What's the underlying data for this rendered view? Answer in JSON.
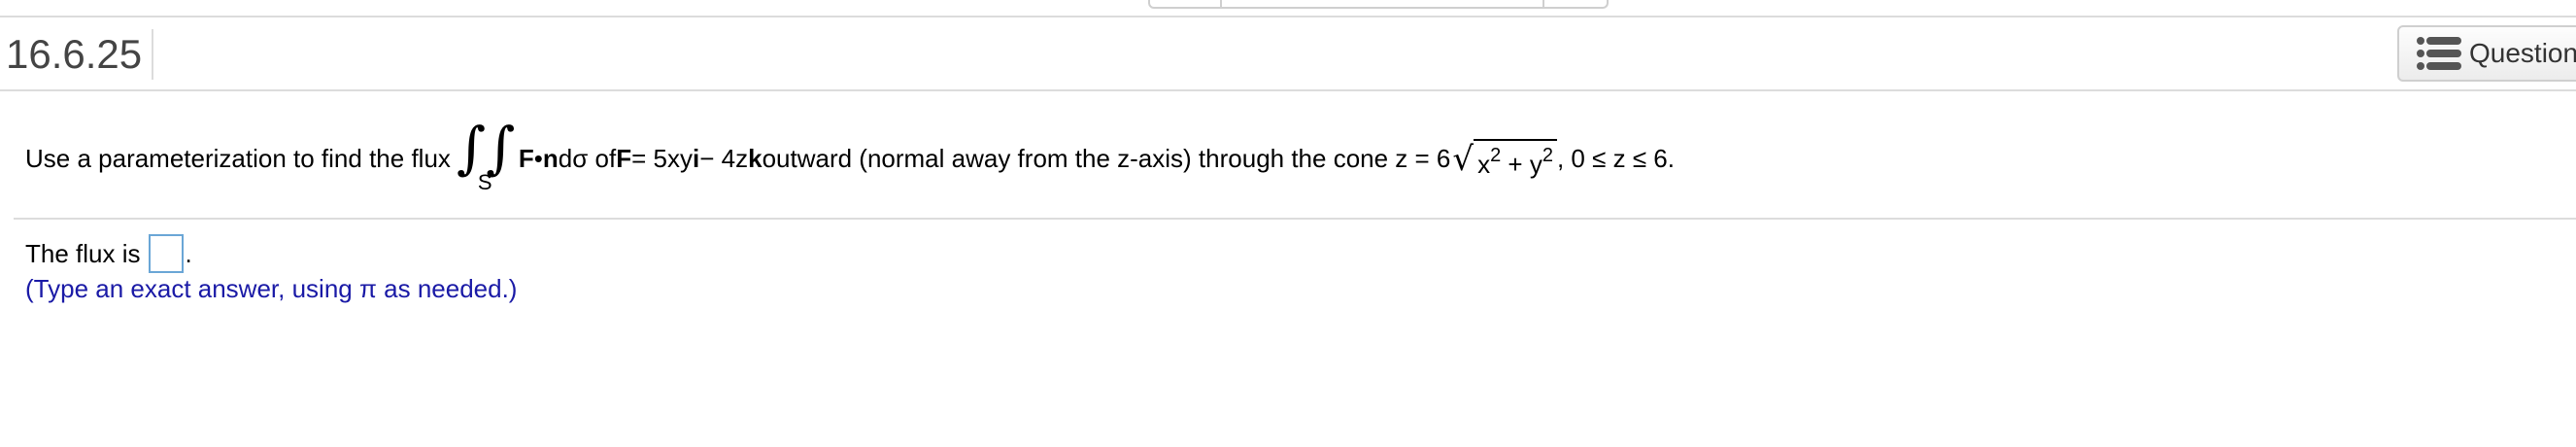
{
  "header": {
    "question_number": "16.6.25",
    "question_button_label": "Question"
  },
  "problem": {
    "prefix": "Use a parameterization to find the flux",
    "integral_symbol": "∫∫",
    "integral_subscript": "S",
    "f_bold": "F",
    "dot": " • ",
    "n_bold": "n",
    "d_sigma": " dσ of ",
    "f_bold_2": "F",
    "eq_part": " = 5xy ",
    "i_bold": "i",
    "minus_part": " − 4z ",
    "k_bold": "k",
    "suffix": " outward (normal  away from the z-axis) through the cone z = 6",
    "radical": "√",
    "rad_x": "x",
    "rad_exp1": "2",
    "rad_plus": " + y",
    "rad_exp2": "2",
    "tail": " , 0 ≤ z ≤ 6."
  },
  "answer": {
    "prefix": "The flux is",
    "value": "",
    "suffix": ".",
    "hint": "(Type an exact answer, using π as needed.)"
  }
}
